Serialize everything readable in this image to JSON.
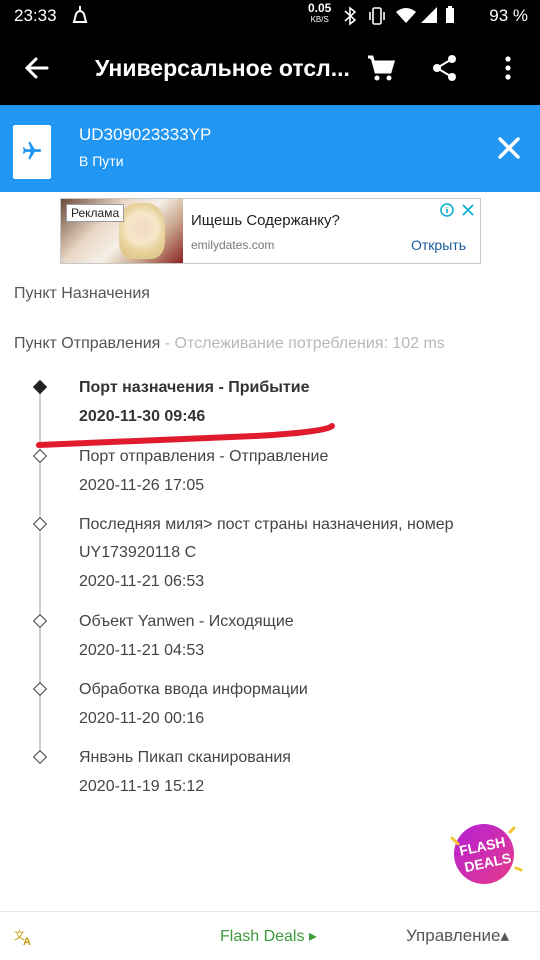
{
  "status_bar": {
    "time": "23:33",
    "net_speed": "0.05",
    "net_unit": "KB/S",
    "battery": "93 %"
  },
  "toolbar": {
    "title": "Универсальное отсл...",
    "icons": [
      "back-arrow-icon",
      "cart-icon",
      "share-icon",
      "more-vert-icon"
    ]
  },
  "tracking": {
    "number": "UD309023333YP",
    "status": "В Пути",
    "icon": "airplane-icon",
    "accent": "#2196f3"
  },
  "ad": {
    "label": "Реклама",
    "headline": "Ищешь Содержанку?",
    "domain": "emilydates.com",
    "cta": "Открыть"
  },
  "destination_label": "Пункт Назначения",
  "origin": {
    "label": "Пункт Отправления",
    "note": " - Отслеживание потребления: 102 ms"
  },
  "events": [
    {
      "title": "Порт назначения - Прибытие",
      "date": "2020-11-30 09:46"
    },
    {
      "title": "Порт отправления - Отправление",
      "date": "2020-11-26 17:05"
    },
    {
      "title": "Последняя миля> пост страны назначения, номер",
      "title2": "UY173920118 C",
      "date": "2020-11-21 06:53"
    },
    {
      "title": "Объект Yanwen - Исходящие",
      "date": "2020-11-21 04:53"
    },
    {
      "title": "Обработка ввода информации",
      "date": "2020-11-20 00:16"
    },
    {
      "title": "Янвэнь Пикап сканирования",
      "date": "2020-11-19 15:12"
    }
  ],
  "flash_badge": {
    "line1": "FLASH",
    "line2": "DEALS"
  },
  "bottom_bar": {
    "flash_deals": "Flash Deals ▸",
    "manage": "Управление▴"
  }
}
